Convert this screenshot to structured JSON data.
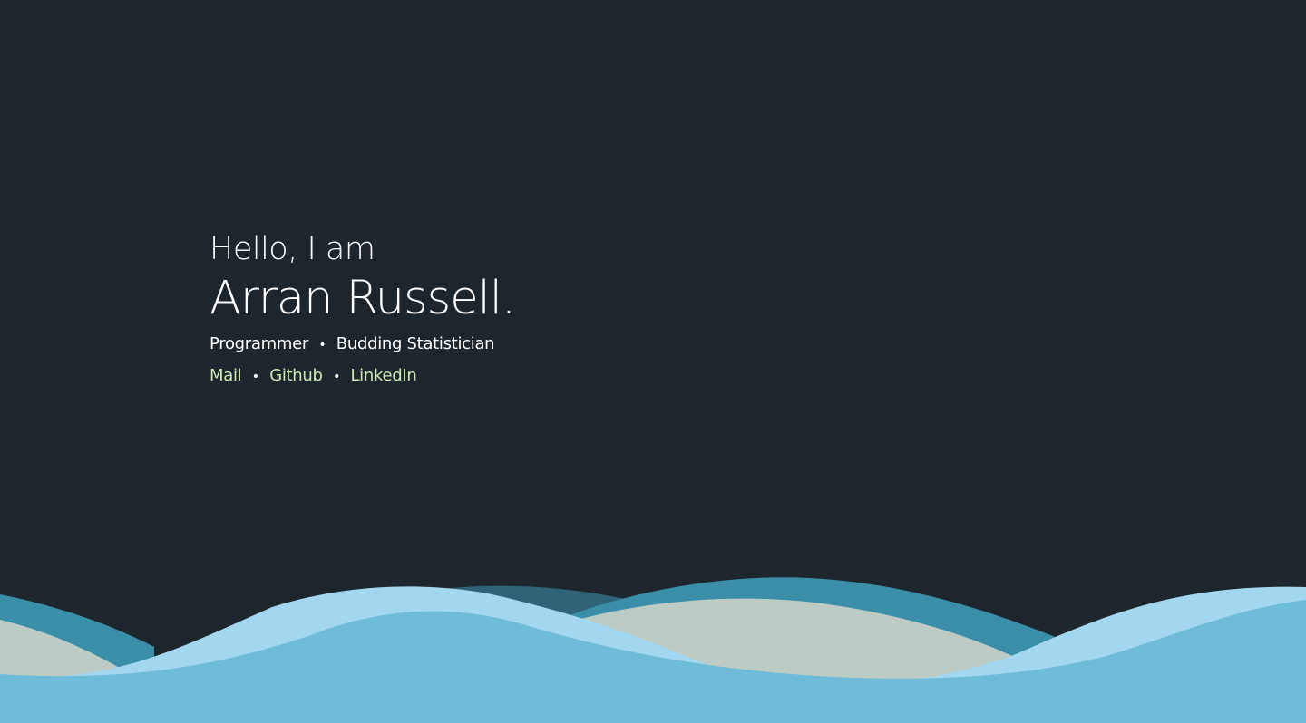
{
  "hero": {
    "greeting": "Hello, I am",
    "name": "Arran Russell.",
    "roles": [
      "Programmer",
      "Budding Statistician"
    ],
    "links": [
      "Mail",
      "Github",
      "LinkedIn"
    ],
    "separator": "•"
  },
  "colors": {
    "background": "#1d262d",
    "link": "#cfe8b4",
    "wave_back": "#3a8ea8",
    "wave_back_dark": "#2f6478",
    "wave_beige": "#bccbc4",
    "wave_light": "#a3d6ef",
    "wave_front": "#6fbcd9"
  }
}
